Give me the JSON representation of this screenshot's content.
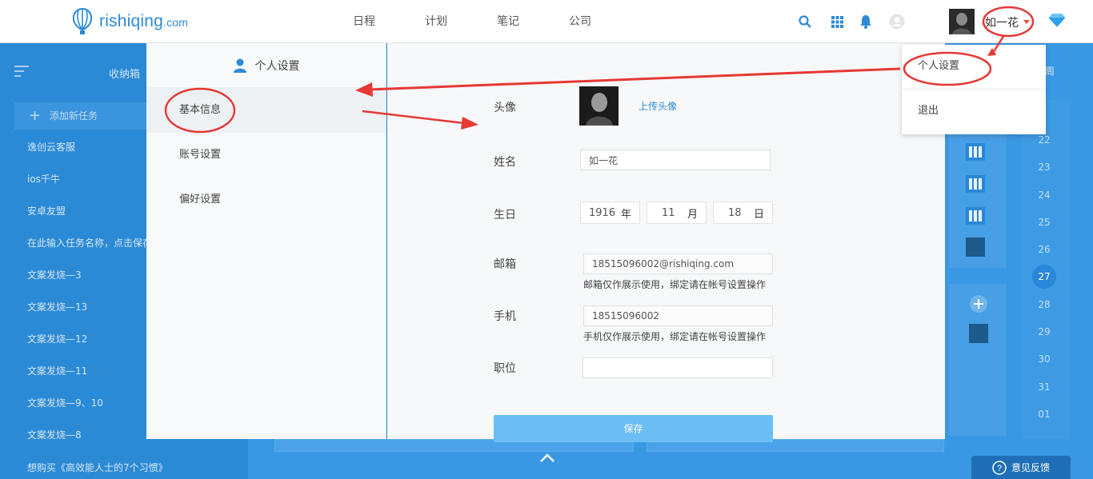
{
  "brand": {
    "name": "rishiqing",
    "suffix": ".com"
  },
  "nav": [
    "日程",
    "计划",
    "笔记",
    "公司"
  ],
  "user": {
    "name": "如一花"
  },
  "icons": {
    "search": "search-icon",
    "apps": "grid-icon",
    "bell": "bell-icon",
    "status": "user-circle-icon",
    "vip": "diamond-icon"
  },
  "background": {
    "inbox_title": "收纳箱",
    "add_task": "添加新任务",
    "tasks": [
      "逸创云客服",
      "ios千牛",
      "安卓友盟",
      "在此输入任务名称，点击保存",
      "文案发烧—3",
      "文案发烧—13",
      "文案发烧—12",
      "文案发烧—11",
      "文案发烧—9、10",
      "文案发烧—8"
    ],
    "bottom_task": "想购买《高效能人士的7个习惯》",
    "week_label": "周",
    "dates": [
      "22",
      "23",
      "24",
      "25",
      "26",
      "28",
      "29",
      "30",
      "31",
      "01"
    ],
    "active_date": "27",
    "feedback": "意见反馈"
  },
  "settings": {
    "title": "个人设置",
    "menu": [
      "基本信息",
      "账号设置",
      "偏好设置"
    ],
    "labels": {
      "avatar": "头像",
      "name": "姓名",
      "birthday": "生日",
      "email": "邮箱",
      "phone": "手机",
      "position": "职位"
    },
    "upload_avatar": "上传头像",
    "name_value": "如一花",
    "birthday": {
      "year": "1916",
      "year_unit": "年",
      "month": "11",
      "month_unit": "月",
      "day": "18",
      "day_unit": "日"
    },
    "email_value": "18515096002@rishiqing.com",
    "email_hint": "邮箱仅作展示使用，绑定请在帐号设置操作",
    "phone_value": "18515096002",
    "phone_hint": "手机仅作展示使用，绑定请在帐号设置操作",
    "position_value": "",
    "save": "保存"
  },
  "dropdown": [
    "个人设置",
    "退出"
  ],
  "annotation_color": "#e53935"
}
